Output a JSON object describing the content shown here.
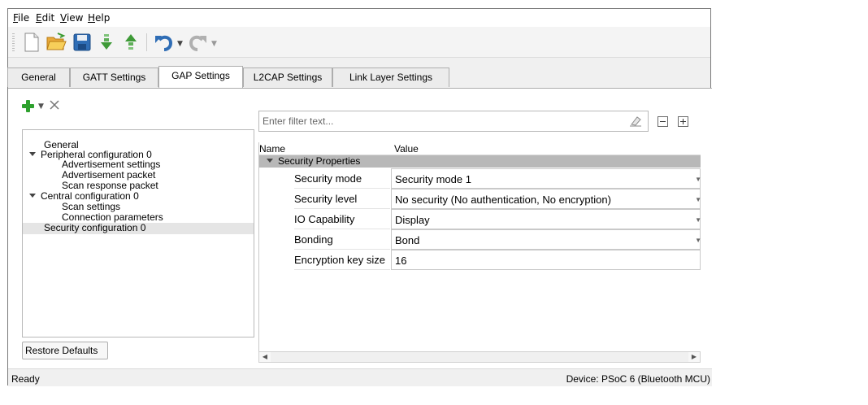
{
  "menubar": {
    "items": [
      {
        "label": "File",
        "accel": "F",
        "rest": "ile"
      },
      {
        "label": "Edit",
        "accel": "E",
        "rest": "dit"
      },
      {
        "label": "View",
        "accel": "V",
        "rest": "iew"
      },
      {
        "label": "Help",
        "accel": "H",
        "rest": "elp"
      }
    ]
  },
  "toolbar": {
    "icons": [
      "new-file-icon",
      "open-folder-icon",
      "save-icon",
      "import-icon",
      "export-icon",
      "undo-icon",
      "redo-icon"
    ]
  },
  "tabs": [
    {
      "label": "General"
    },
    {
      "label": "GATT Settings"
    },
    {
      "label": "GAP Settings",
      "active": true
    },
    {
      "label": "L2CAP Settings"
    },
    {
      "label": "Link Layer Settings"
    }
  ],
  "tree": {
    "items": [
      {
        "label": "General",
        "level": 0
      },
      {
        "label": "Peripheral configuration 0",
        "level": 0,
        "expanded": true
      },
      {
        "label": "Advertisement settings",
        "level": 1
      },
      {
        "label": "Advertisement packet",
        "level": 1
      },
      {
        "label": "Scan response packet",
        "level": 1
      },
      {
        "label": "Central configuration 0",
        "level": 0,
        "expanded": true
      },
      {
        "label": "Scan settings",
        "level": 1
      },
      {
        "label": "Connection parameters",
        "level": 1
      },
      {
        "label": "Security configuration 0",
        "level": 0,
        "selected": true
      }
    ],
    "restore_label": "Restore Defaults"
  },
  "filter": {
    "placeholder": "Enter filter text..."
  },
  "grid": {
    "col_name": "Name",
    "col_value": "Value",
    "section": "Security Properties",
    "rows": [
      {
        "name": "Security mode",
        "value": "Security mode 1",
        "dropdown": true
      },
      {
        "name": "Security level",
        "value": "No security (No authentication, No encryption)",
        "dropdown": true
      },
      {
        "name": "IO Capability",
        "value": "Display",
        "dropdown": true
      },
      {
        "name": "Bonding",
        "value": "Bond",
        "dropdown": true
      },
      {
        "name": "Encryption key size",
        "value": "16",
        "dropdown": false
      }
    ]
  },
  "status": {
    "left": "Ready",
    "right": "Device: PSoC 6 (Bluetooth MCU)"
  }
}
